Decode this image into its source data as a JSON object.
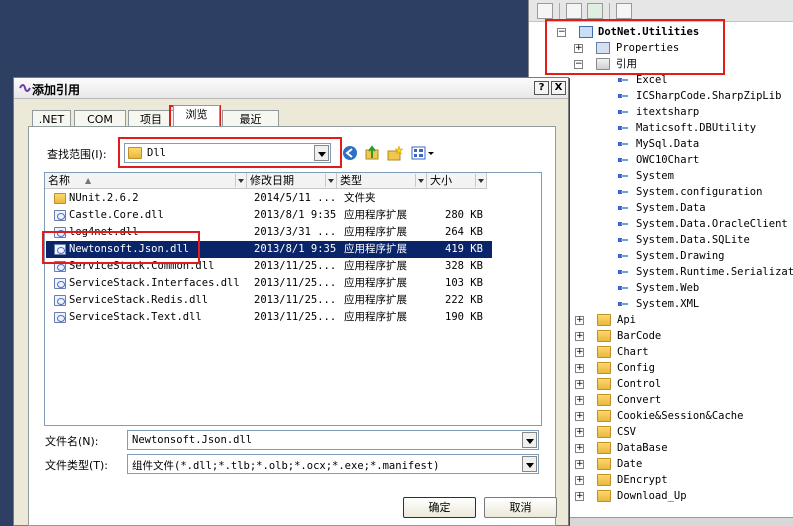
{
  "dialog": {
    "title": "添加引用",
    "help_button": "?",
    "close_button": "X",
    "tabs": [
      ".NET",
      "COM",
      "项目",
      "浏览",
      "最近"
    ],
    "active_tab": "浏览",
    "look_in_label": "查找范围(I):",
    "look_in_value": "Dll",
    "columns": [
      "名称",
      "修改日期",
      "类型",
      "大小"
    ],
    "files": [
      {
        "name": "NUnit.2.6.2",
        "date": "2014/5/11 ...",
        "type": "文件夹",
        "size": "",
        "icon": "folder-icon"
      },
      {
        "name": "Castle.Core.dll",
        "date": "2013/8/1 9:35",
        "type": "应用程序扩展",
        "size": "280 KB",
        "icon": "dll-icon"
      },
      {
        "name": "log4net.dll",
        "date": "2013/3/31 ...",
        "type": "应用程序扩展",
        "size": "264 KB",
        "icon": "dll-icon"
      },
      {
        "name": "Newtonsoft.Json.dll",
        "date": "2013/8/1 9:35",
        "type": "应用程序扩展",
        "size": "419 KB",
        "icon": "dll-icon",
        "selected": true
      },
      {
        "name": "ServiceStack.Common.dll",
        "date": "2013/11/25...",
        "type": "应用程序扩展",
        "size": "328 KB",
        "icon": "dll-icon"
      },
      {
        "name": "ServiceStack.Interfaces.dll",
        "date": "2013/11/25...",
        "type": "应用程序扩展",
        "size": "103 KB",
        "icon": "dll-icon"
      },
      {
        "name": "ServiceStack.Redis.dll",
        "date": "2013/11/25...",
        "type": "应用程序扩展",
        "size": "222 KB",
        "icon": "dll-icon"
      },
      {
        "name": "ServiceStack.Text.dll",
        "date": "2013/11/25...",
        "type": "应用程序扩展",
        "size": "190 KB",
        "icon": "dll-icon"
      }
    ],
    "filename_label": "文件名(N):",
    "filename_value": "Newtonsoft.Json.dll",
    "filetype_label": "文件类型(T):",
    "filetype_value": "组件文件(*.dll;*.tlb;*.olb;*.ocx;*.exe;*.manifest)",
    "ok_button": "确定",
    "cancel_button": "取消"
  },
  "solution_explorer": {
    "project": "DotNet.Utilities",
    "properties": "Properties",
    "references_label": "引用",
    "references": [
      "Excel",
      "ICSharpCode.SharpZipLib",
      "itextsharp",
      "Maticsoft.DBUtility",
      "MySql.Data",
      "OWC10Chart",
      "System",
      "System.configuration",
      "System.Data",
      "System.Data.OracleClient",
      "System.Data.SQLite",
      "System.Drawing",
      "System.Runtime.Serializati",
      "System.Web",
      "System.XML"
    ],
    "folders": [
      "Api",
      "BarCode",
      "Chart",
      "Config",
      "Control",
      "Convert",
      "Cookie&Session&Cache",
      "CSV",
      "DataBase",
      "Date",
      "DEncrypt",
      "Download_Up"
    ]
  },
  "colors": {
    "highlight": "#e21b1b",
    "selection": "#0a246a"
  }
}
